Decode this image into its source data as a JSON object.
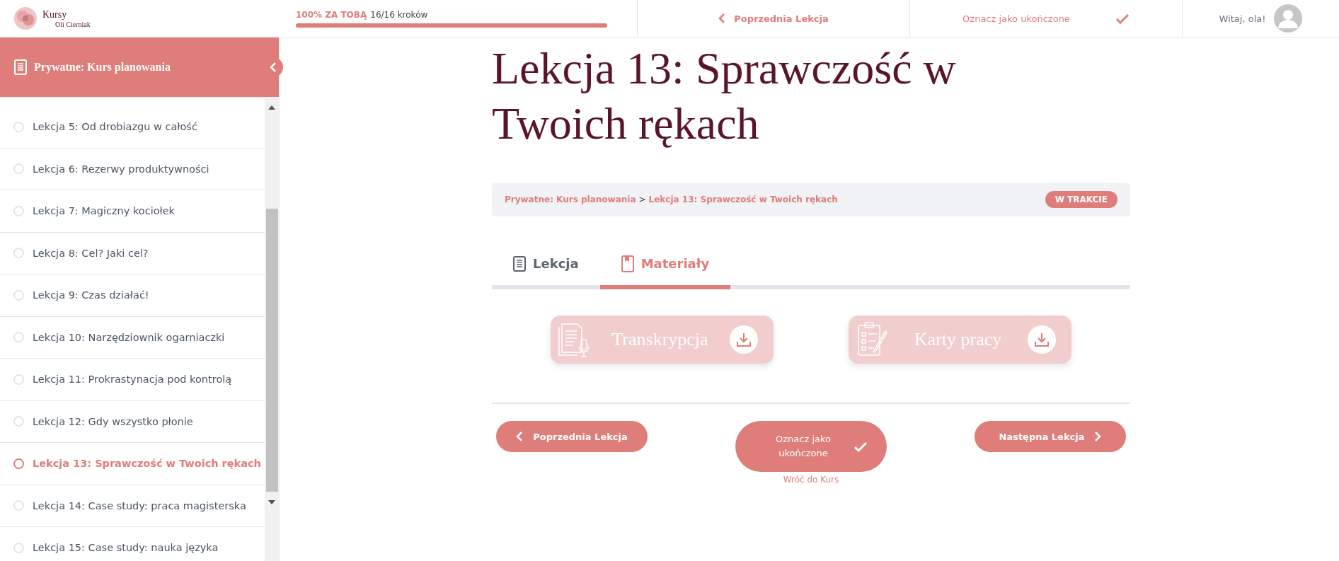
{
  "logo": {
    "line1": "Kursy",
    "line2": "Oli Cierniak"
  },
  "progress": {
    "label": "100% ZA TOBĄ",
    "steps": "16/16 kroków",
    "level": 1
  },
  "top_nav": {
    "previous": "Poprzednia Lekcja",
    "mark_complete": "Oznacz jako ukończone",
    "greeting": "Witaj, ola!"
  },
  "sidebar": {
    "course_title": "Prywatne: Kurs planowania",
    "lessons": [
      {
        "title": "Lekcja 5: Od drobiazgu w całość",
        "selected": false
      },
      {
        "title": "Lekcja 6: Rezerwy produktywności",
        "selected": false
      },
      {
        "title": "Lekcja 7: Magiczny kociołek",
        "selected": false
      },
      {
        "title": "Lekcja 8: Cel? Jaki cel?",
        "selected": false
      },
      {
        "title": "Lekcja 9: Czas działać!",
        "selected": false
      },
      {
        "title": "Lekcja 10: Narzędziownik ogarniaczki",
        "selected": false
      },
      {
        "title": "Lekcja 11: Prokrastynacja pod kontrolą",
        "selected": false
      },
      {
        "title": "Lekcja 12: Gdy wszystko płonie",
        "selected": false
      },
      {
        "title": "Lekcja 13: Sprawczość w Twoich rękach",
        "selected": true
      },
      {
        "title": "Lekcja 14: Case study: praca magisterska",
        "selected": false
      },
      {
        "title": "Lekcja 15: Case study: nauka języka",
        "selected": false
      }
    ]
  },
  "lesson_title": "Lekcja 13: Sprawczość w Twoich rękach",
  "breadcrumb": {
    "course": "Prywatne: Kurs planowania",
    "separator": ">",
    "lesson": "Lekcja 13: Sprawczość w Twoich rękach",
    "status": "W TRAKCIE"
  },
  "tabs": [
    {
      "label": "Lekcja",
      "kind": "document",
      "selected": false
    },
    {
      "label": "Materiały",
      "kind": "bookmark",
      "selected": true
    }
  ],
  "materials": [
    {
      "label": "Transkrypcja",
      "kind": "transcript"
    },
    {
      "label": "Karty pracy",
      "kind": "worksheet"
    }
  ],
  "footer_nav": {
    "previous": "Poprzednia Lekcja",
    "mark_complete": "Oznacz jako ukończone",
    "next": "Następna Lekcja",
    "back_link": "Wróć do Kurs"
  }
}
